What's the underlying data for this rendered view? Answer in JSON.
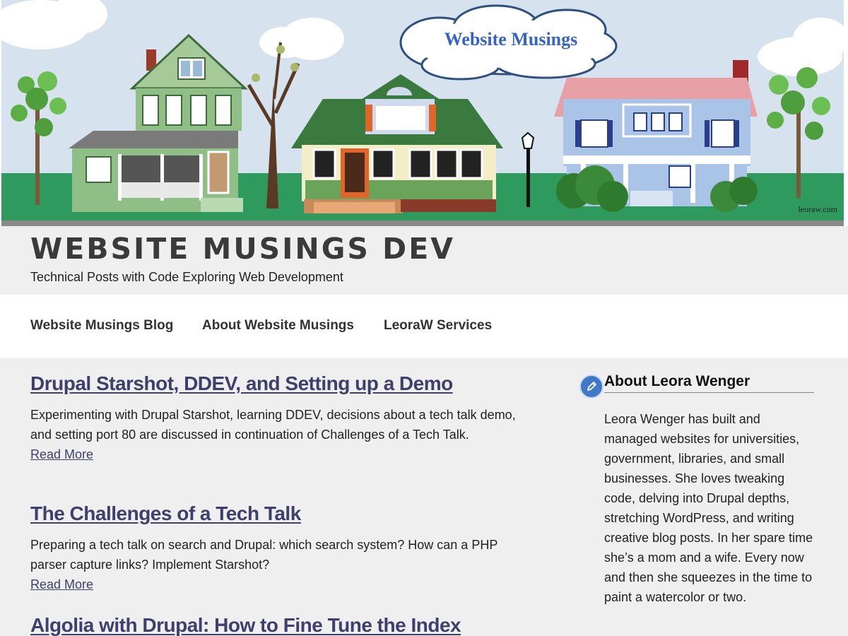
{
  "banner": {
    "cloud_title": "Website Musings",
    "credit": "leoraw.com"
  },
  "site": {
    "title": "WEBSITE MUSINGS DEV",
    "tagline": "Technical Posts with Code Exploring Web Development"
  },
  "nav": {
    "items": [
      {
        "label": "Website Musings Blog"
      },
      {
        "label": "About Website Musings"
      },
      {
        "label": "LeoraW Services"
      }
    ]
  },
  "posts": [
    {
      "title": "Drupal Starshot, DDEV, and Setting up a Demo",
      "excerpt": "Experimenting with Drupal Starshot, learning DDEV, decisions about a tech talk demo, and setting port 80 are discussed in continuation of Challenges of a Tech Talk.",
      "read_more": "Read More"
    },
    {
      "title": "The Challenges of a Tech Talk",
      "excerpt": "Preparing a tech talk on search and Drupal: which search system? How can a PHP parser capture links? Implement Starshot?",
      "read_more": "Read More"
    },
    {
      "title": "Algolia with Drupal: How to Fine Tune the Index"
    }
  ],
  "sidebar": {
    "icon": "pencil-icon",
    "heading": "About Leora Wenger",
    "text": "Leora Wenger has built and managed websites for universities, government, libraries, and small businesses. She loves tweaking code, delving into Drupal depths, stretching WordPress, and writing creative blog posts. In her spare time she’s a mom and a wife. Every now and then she squeezes in the time to paint a watercolor or two."
  },
  "colors": {
    "link": "#3f3f6d",
    "title": "#3a3a3a",
    "sky": "#d6e2ee",
    "grass": "#2e9a5d"
  }
}
